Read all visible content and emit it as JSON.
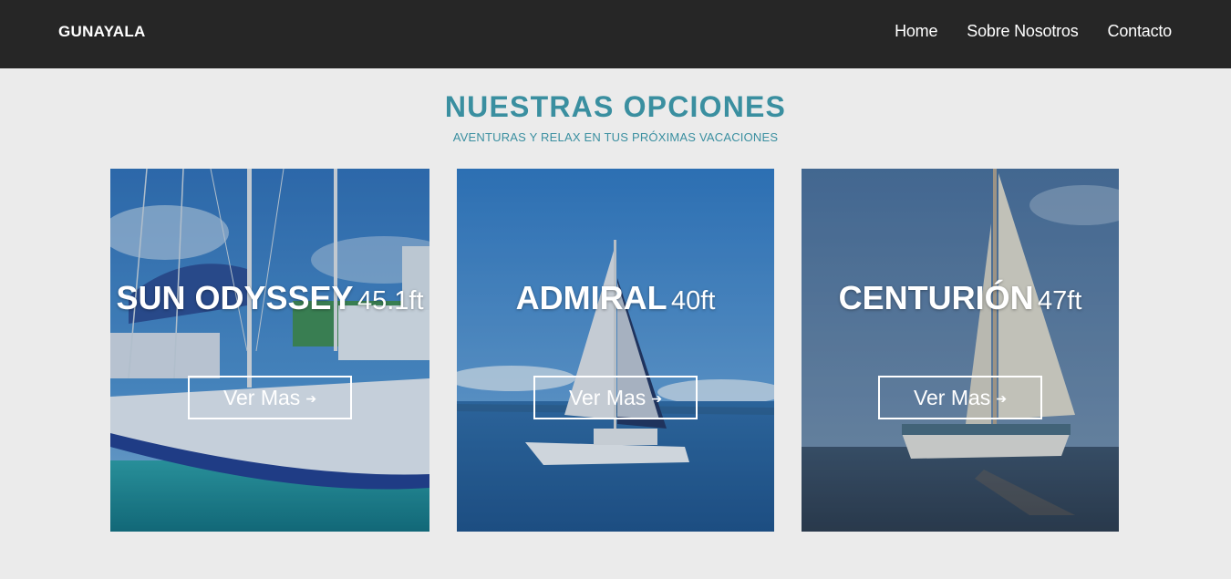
{
  "navbar": {
    "brand": "GUNAYALA",
    "links": [
      "Home",
      "Sobre Nosotros",
      "Contacto"
    ]
  },
  "section": {
    "title": "NUESTRAS OPCIONES",
    "subtitle": "AVENTURAS Y RELAX EN TUS PRÓXIMAS VACACIONES"
  },
  "cards": [
    {
      "name": "SUN ODYSSEY",
      "size": "45.1ft",
      "button": "Ver Mas",
      "arrow": "➔"
    },
    {
      "name": "ADMIRAL",
      "size": "40ft",
      "button": "Ver Mas",
      "arrow": "➔"
    },
    {
      "name": "CENTURIÓN",
      "size": "47ft",
      "button": "Ver Mas",
      "arrow": "➔"
    }
  ],
  "colors": {
    "navbar_bg": "#262626",
    "page_bg": "#ebebeb",
    "accent": "#3a8fa0"
  },
  "icons": {
    "button_arrow": "arrow-right-icon"
  }
}
